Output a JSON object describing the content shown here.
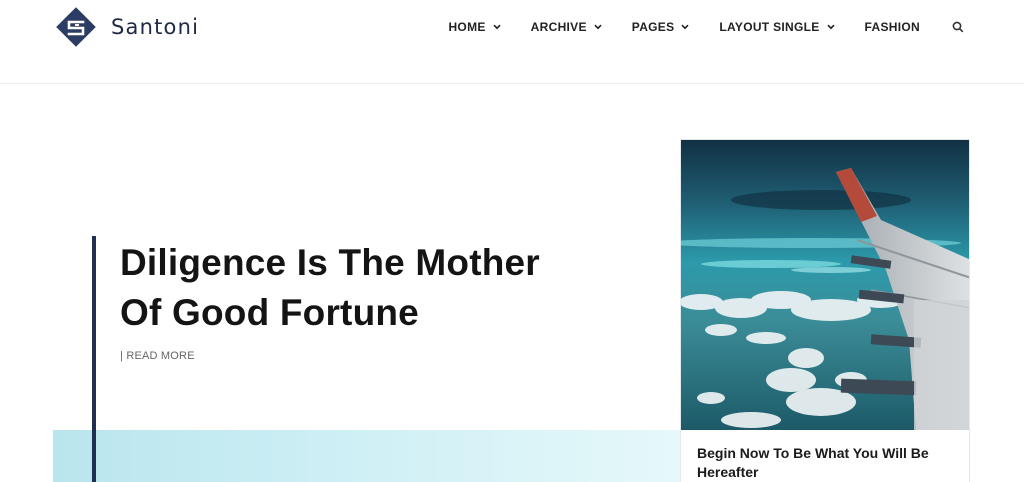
{
  "brand": {
    "name": "Santoni",
    "icon": "santoni-logo-mark",
    "color": "#2b3d63"
  },
  "nav": {
    "items": [
      {
        "label": "HOME",
        "has_dropdown": true
      },
      {
        "label": "ARCHIVE",
        "has_dropdown": true
      },
      {
        "label": "PAGES",
        "has_dropdown": true
      },
      {
        "label": "LAYOUT SINGLE",
        "has_dropdown": true
      },
      {
        "label": "FASHION",
        "has_dropdown": false
      }
    ],
    "search_icon": "search-icon"
  },
  "hero": {
    "title": "Diligence Is The Mother Of Good Fortune",
    "read_more": "| READ MORE",
    "accent_color": "#1e2f52"
  },
  "featured_card": {
    "image": "airplane-wing-over-clouds",
    "title": "Begin Now To Be What You Will Be Hereafter"
  }
}
